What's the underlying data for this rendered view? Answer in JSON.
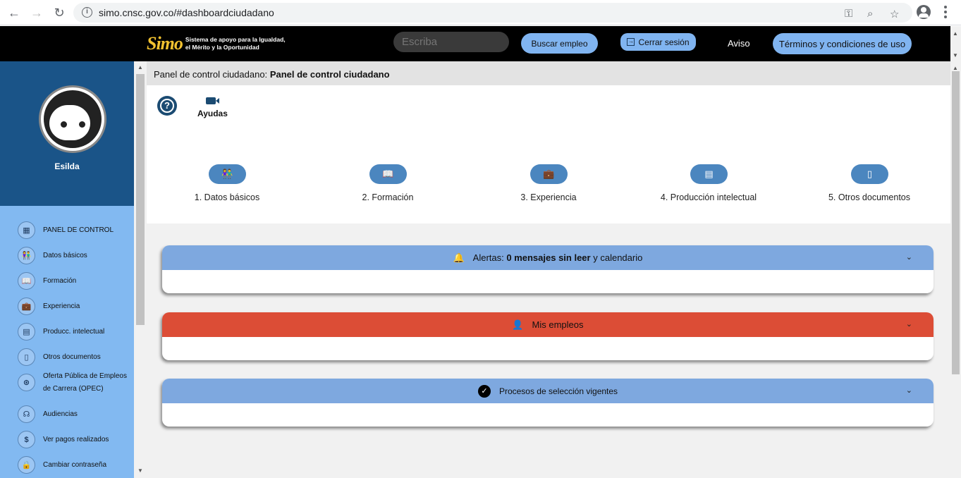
{
  "browser": {
    "url": "simo.cnsc.gov.co/#dashboardciudadano"
  },
  "header": {
    "logo_mark": "Simo",
    "logo_line1": "Sistema de apoyo para la Igualdad,",
    "logo_line2": "el Mérito y la Oportunidad",
    "search_placeholder": "Escriba",
    "search_job_label": "Buscar empleo",
    "logout_label": "Cerrar sesión",
    "aviso_label": "Aviso",
    "terms_label": "Términos y condiciones de uso"
  },
  "sidebar": {
    "user_name": "Esilda",
    "items": [
      {
        "label": "PANEL DE CONTROL",
        "icon": "dashboard-icon"
      },
      {
        "label": "Datos básicos",
        "icon": "people-icon"
      },
      {
        "label": "Formación",
        "icon": "book-icon"
      },
      {
        "label": "Experiencia",
        "icon": "briefcase-icon"
      },
      {
        "label": "Producc. intelectual",
        "icon": "library-icon"
      },
      {
        "label": "Otros documentos",
        "icon": "document-icon"
      },
      {
        "label": "Oferta Pública de Empleos de Carrera (OPEC)",
        "icon": "opec-icon"
      },
      {
        "label": "Audiencias",
        "icon": "audience-icon"
      },
      {
        "label": "Ver pagos realizados",
        "icon": "dollar-icon"
      },
      {
        "label": "Cambiar contraseña",
        "icon": "lock-icon"
      }
    ]
  },
  "main": {
    "breadcrumb_prefix": "Panel de control ciudadano:",
    "breadcrumb_current": "Panel de control ciudadano",
    "help_label": "Ayudas",
    "steps": [
      {
        "label": "1. Datos básicos",
        "icon": "people-icon"
      },
      {
        "label": "2. Formación",
        "icon": "book-icon"
      },
      {
        "label": "3. Experiencia",
        "icon": "briefcase-icon"
      },
      {
        "label": "4. Producción intelectual",
        "icon": "library-icon"
      },
      {
        "label": "5. Otros documentos",
        "icon": "document-icon"
      }
    ],
    "alerts": {
      "prefix": "Alertas:",
      "bold": "0 mensajes sin leer",
      "suffix": "y calendario"
    },
    "jobs_title": "Mis empleos",
    "processes_title": "Procesos de selección vigentes"
  },
  "colors": {
    "sidebar_light": "#82b9f1",
    "sidebar_dark": "#1a5488",
    "accent_blue": "#7ea8df",
    "jobs_red": "#dc4d36"
  }
}
